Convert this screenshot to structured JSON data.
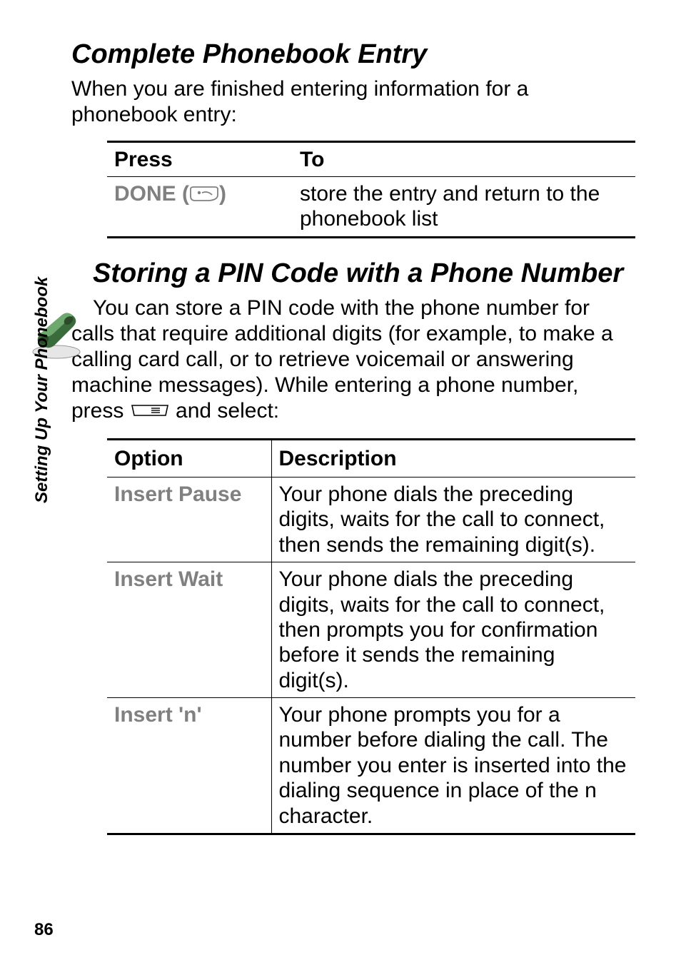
{
  "section1": {
    "heading": "Complete Phonebook Entry",
    "intro": "When you are finished entering information for a phonebook entry:",
    "table": {
      "head": {
        "c1": "Press",
        "c2": "To"
      },
      "row": {
        "press_label": "DONE",
        "press_paren_open": "(",
        "press_paren_close": ")",
        "to": "store the entry and return to the phonebook list"
      }
    }
  },
  "section2": {
    "heading": "Storing a PIN Code with a Phone Number",
    "intro_part1": "You can store a PIN code with the phone number for calls that require additional digits (for example, to make a calling ",
    "intro_part2": "card call, or to retrieve voicemail or answering machine messages). While entering a phone number, press ",
    "intro_part3": " and select:",
    "table": {
      "head": {
        "c1": "Option",
        "c2": "Description"
      },
      "rows": [
        {
          "c1": "Insert Pause",
          "c2": "Your phone dials the preceding digits, waits for the call to connect, then sends the remaining digit(s)."
        },
        {
          "c1": "Insert Wait",
          "c2": "Your phone dials the preceding digits, waits for the call to connect, then prompts you for confirmation before it sends the remaining digit(s)."
        },
        {
          "c1": "Insert 'n'",
          "c2_pre": "Your phone prompts you for a number before dialing the call. The number you enter is inserted into the dialing sequence in place of the ",
          "c2_n": "n",
          "c2_post": " character."
        }
      ]
    }
  },
  "side_label": "Setting Up Your Phonebook",
  "page_number": "86",
  "icons": {
    "softkey": "softkey-right-icon",
    "menu": "menu-key-icon",
    "phone": "phone-handle-icon"
  }
}
